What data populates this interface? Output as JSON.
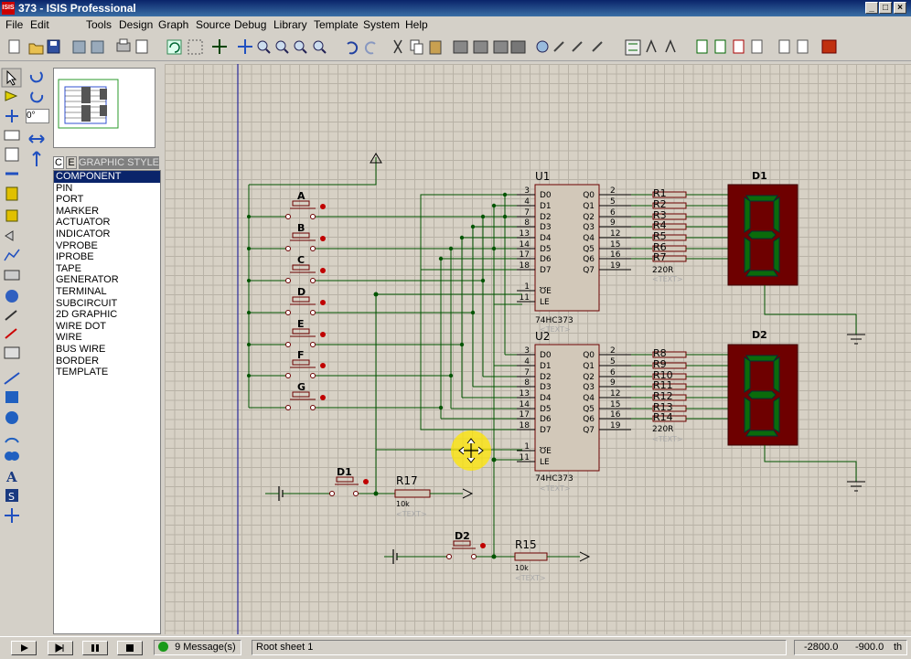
{
  "window": {
    "title": "373 - ISIS Professional",
    "icon_text": "ISIS"
  },
  "menu": [
    "File",
    "Edit",
    "Tools",
    "Design",
    "Graph",
    "Source",
    "Debug",
    "Library",
    "Template",
    "System",
    "Help"
  ],
  "left_panel": {
    "rotation_value": "0°",
    "tab_c": "C",
    "tab_e": "E",
    "tab_label": "GRAPHIC STYLES",
    "modes": [
      "COMPONENT",
      "PIN",
      "PORT",
      "MARKER",
      "ACTUATOR",
      "INDICATOR",
      "VPROBE",
      "IPROBE",
      "TAPE",
      "GENERATOR",
      "TERMINAL",
      "SUBCIRCUIT",
      "2D GRAPHIC",
      "WIRE DOT",
      "WIRE",
      "BUS WIRE",
      "BORDER",
      "TEMPLATE"
    ],
    "selected_mode": "COMPONENT"
  },
  "schematic": {
    "chips": [
      {
        "ref": "U1",
        "part": "74HC373",
        "text": "<TEXT>",
        "left_pins": [
          {
            "num": "3",
            "name": "D0"
          },
          {
            "num": "4",
            "name": "D1"
          },
          {
            "num": "7",
            "name": "D2"
          },
          {
            "num": "8",
            "name": "D3"
          },
          {
            "num": "13",
            "name": "D4"
          },
          {
            "num": "14",
            "name": "D5"
          },
          {
            "num": "17",
            "name": "D6"
          },
          {
            "num": "18",
            "name": "D7"
          },
          {
            "num": "1",
            "name": "OE"
          },
          {
            "num": "11",
            "name": "LE"
          }
        ],
        "right_pins": [
          {
            "num": "2",
            "name": "Q0"
          },
          {
            "num": "5",
            "name": "Q1"
          },
          {
            "num": "6",
            "name": "Q2"
          },
          {
            "num": "9",
            "name": "Q3"
          },
          {
            "num": "12",
            "name": "Q4"
          },
          {
            "num": "15",
            "name": "Q5"
          },
          {
            "num": "16",
            "name": "Q6"
          },
          {
            "num": "19",
            "name": "Q7"
          }
        ]
      },
      {
        "ref": "U2",
        "part": "74HC373",
        "text": "<TEXT>",
        "left_pins": [
          {
            "num": "3",
            "name": "D0"
          },
          {
            "num": "4",
            "name": "D1"
          },
          {
            "num": "7",
            "name": "D2"
          },
          {
            "num": "8",
            "name": "D3"
          },
          {
            "num": "13",
            "name": "D4"
          },
          {
            "num": "14",
            "name": "D5"
          },
          {
            "num": "17",
            "name": "D6"
          },
          {
            "num": "18",
            "name": "D7"
          },
          {
            "num": "1",
            "name": "OE"
          },
          {
            "num": "11",
            "name": "LE"
          }
        ],
        "right_pins": [
          {
            "num": "2",
            "name": "Q0"
          },
          {
            "num": "5",
            "name": "Q1"
          },
          {
            "num": "6",
            "name": "Q2"
          },
          {
            "num": "9",
            "name": "Q3"
          },
          {
            "num": "12",
            "name": "Q4"
          },
          {
            "num": "15",
            "name": "Q5"
          },
          {
            "num": "16",
            "name": "Q6"
          },
          {
            "num": "19",
            "name": "Q7"
          }
        ]
      }
    ],
    "displays": [
      {
        "ref": "D1"
      },
      {
        "ref": "D2"
      }
    ],
    "resistor_arrays": [
      {
        "refs": [
          "R1",
          "R2",
          "R3",
          "R4",
          "R5",
          "R6",
          "R7"
        ],
        "value": "220R",
        "text": "<TEXT>"
      },
      {
        "refs": [
          "R8",
          "R9",
          "R10",
          "R11",
          "R12",
          "R13",
          "R14"
        ],
        "value": "220R",
        "text": "<TEXT>"
      }
    ],
    "buttons": [
      "A",
      "B",
      "C",
      "D",
      "E",
      "F",
      "G"
    ],
    "latch_buttons": [
      {
        "ref": "D1",
        "resistor": "R17",
        "value": "10k",
        "text": "<TEXT>"
      },
      {
        "ref": "D2",
        "resistor": "R15",
        "value": "10k",
        "text": "<TEXT>"
      }
    ]
  },
  "status": {
    "messages": "9 Message(s)",
    "sheet": "Root sheet 1",
    "coord_x": "-2800.0",
    "coord_y": "-900.0",
    "units": "th"
  },
  "colors": {
    "wire": "#005400",
    "component_body": "#d2c8b9",
    "display_bg": "#6e0000",
    "segment": "#0b6b0b",
    "pin_red": "#b00000",
    "title_blue": "#0a246a"
  }
}
